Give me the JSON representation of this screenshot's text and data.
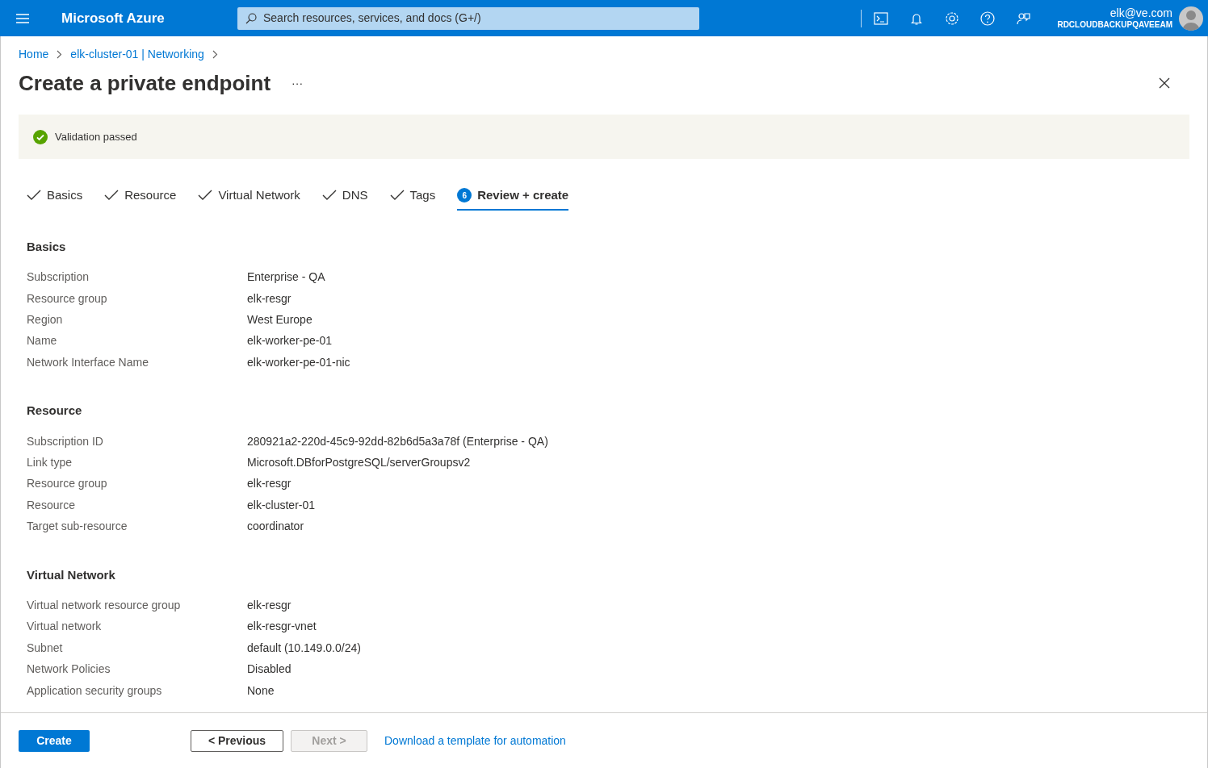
{
  "topbar": {
    "brand": "Microsoft Azure",
    "search_placeholder": "Search resources, services, and docs (G+/)",
    "user_email": "elk@ve.com",
    "user_directory": "RDCLOUDBACKUPQAVEEAM"
  },
  "breadcrumb": [
    "Home",
    "elk-cluster-01 | Networking"
  ],
  "page_title": "Create a private endpoint",
  "more": "···",
  "validation": {
    "passed": true,
    "message": "Validation passed"
  },
  "tabs": [
    {
      "label": "Basics",
      "completed": true,
      "selected": false
    },
    {
      "label": "Resource",
      "completed": true,
      "selected": false
    },
    {
      "label": "Virtual Network",
      "completed": true,
      "selected": false
    },
    {
      "label": "DNS",
      "completed": true,
      "selected": false
    },
    {
      "label": "Tags",
      "completed": true,
      "selected": false
    },
    {
      "label": "Review + create",
      "completed": false,
      "selected": true,
      "step": "6"
    }
  ],
  "sections": [
    {
      "title": "Basics",
      "rows": [
        {
          "label": "Subscription",
          "value": "Enterprise - QA"
        },
        {
          "label": "Resource group",
          "value": "elk-resgr"
        },
        {
          "label": "Region",
          "value": "West Europe"
        },
        {
          "label": "Name",
          "value": "elk-worker-pe-01"
        },
        {
          "label": "Network Interface Name",
          "value": "elk-worker-pe-01-nic"
        }
      ]
    },
    {
      "title": "Resource",
      "rows": [
        {
          "label": "Subscription ID",
          "value": "280921a2-220d-45c9-92dd-82b6d5a3a78f (Enterprise - QA)"
        },
        {
          "label": "Link type",
          "value": "Microsoft.DBforPostgreSQL/serverGroupsv2"
        },
        {
          "label": "Resource group",
          "value": "elk-resgr"
        },
        {
          "label": "Resource",
          "value": "elk-cluster-01"
        },
        {
          "label": "Target sub-resource",
          "value": "coordinator"
        }
      ]
    },
    {
      "title": "Virtual Network",
      "rows": [
        {
          "label": "Virtual network resource group",
          "value": "elk-resgr"
        },
        {
          "label": "Virtual network",
          "value": "elk-resgr-vnet"
        },
        {
          "label": "Subnet",
          "value": "default (10.149.0.0/24)"
        },
        {
          "label": "Network Policies",
          "value": "Disabled"
        },
        {
          "label": "Application security groups",
          "value": "None"
        }
      ]
    }
  ],
  "footer": {
    "buttons": [
      {
        "label": "Create",
        "kind": "primary",
        "disabled": false
      },
      {
        "label": "< Previous",
        "kind": "secondary",
        "disabled": false
      },
      {
        "label": "Next >",
        "kind": "secondary",
        "disabled": true
      }
    ],
    "link": "Download a template for automation"
  }
}
